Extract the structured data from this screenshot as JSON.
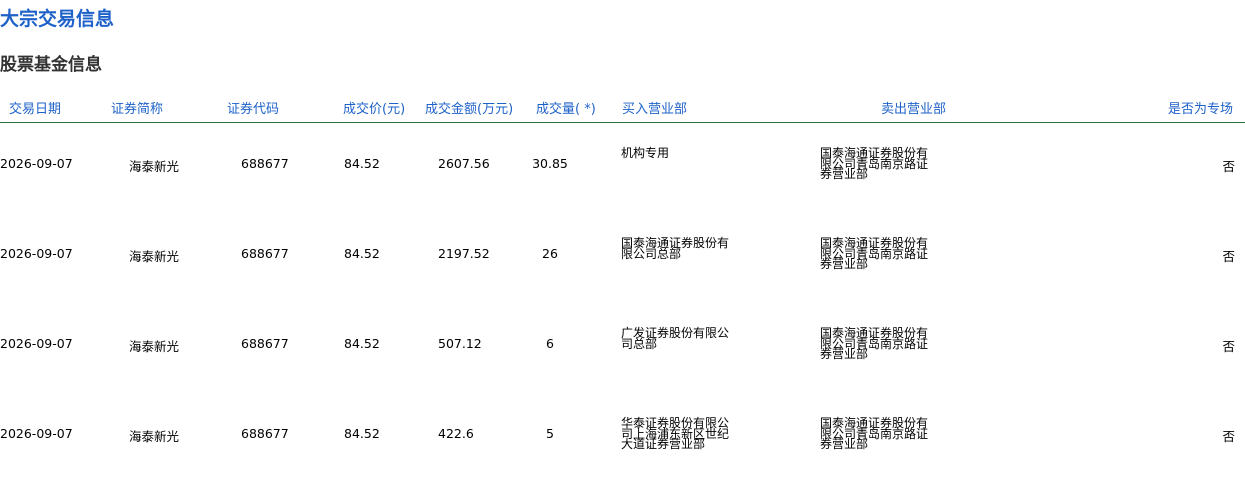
{
  "page": {
    "title": "大宗交易信息",
    "section_title": "股票基金信息"
  },
  "table": {
    "headers": [
      "交易日期",
      "证券简称",
      "证券代码",
      "成交价(元)",
      "成交金额(万元)",
      "成交量( *)",
      "买入营业部",
      "卖出营业部",
      "是否为专场"
    ],
    "rows": [
      {
        "date": "2026-09-07",
        "name": "海泰新光",
        "code": "688677",
        "price": "84.52",
        "amount": "2607.56",
        "volume": "30.85",
        "buyer": "机构专用",
        "seller": "国泰海通证券股份有限公司青岛南京路证券营业部",
        "special": "否"
      },
      {
        "date": "2026-09-07",
        "name": "海泰新光",
        "code": "688677",
        "price": "84.52",
        "amount": "2197.52",
        "volume": "26",
        "buyer": "国泰海通证券股份有限公司总部",
        "seller": "国泰海通证券股份有限公司青岛南京路证券营业部",
        "special": "否"
      },
      {
        "date": "2026-09-07",
        "name": "海泰新光",
        "code": "688677",
        "price": "84.52",
        "amount": "507.12",
        "volume": "6",
        "buyer": "广发证券股份有限公司总部",
        "seller": "国泰海通证券股份有限公司青岛南京路证券营业部",
        "special": "否"
      },
      {
        "date": "2026-09-07",
        "name": "海泰新光",
        "code": "688677",
        "price": "84.52",
        "amount": "422.6",
        "volume": "5",
        "buyer": "华泰证券股份有限公司上海浦东新区世纪大道证券营业部",
        "seller": "国泰海通证券股份有限公司青岛南京路证券营业部",
        "special": "否"
      }
    ]
  },
  "colors": {
    "title": "#1e62c9",
    "header_text": "#1e62c9",
    "header_rule": "#2f6e3f"
  }
}
